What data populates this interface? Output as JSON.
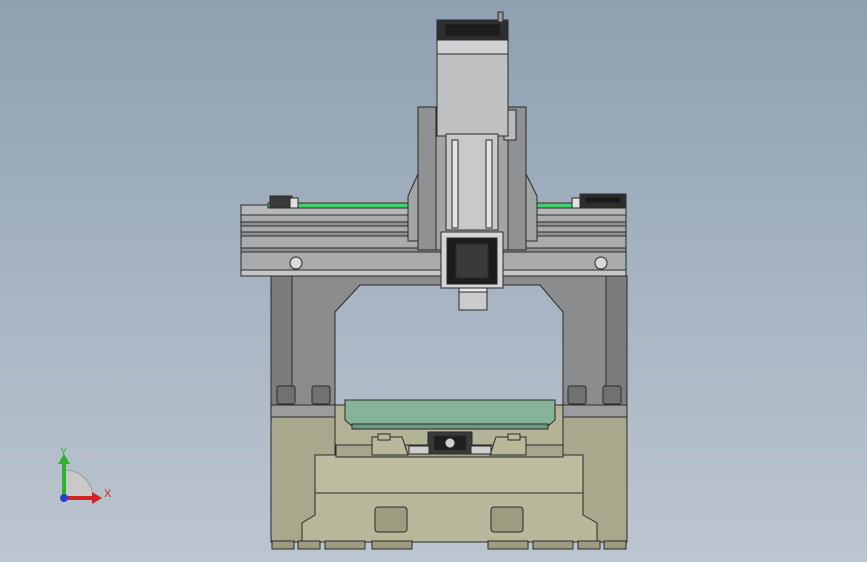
{
  "viewport": {
    "colors": {
      "background_top": "#8fa0b1",
      "background_bottom": "#bcc6d0",
      "base_casting": "#b3b396",
      "base_casting_dark": "#9c9c80",
      "column": "#8a8c8e",
      "column_dark": "#727476",
      "beam": "#a9abad",
      "linear_rail": "#3fd36a",
      "spindle_head": "#bfc1c3",
      "worktable": "#88b39b",
      "worktable_dark": "#6e9a82",
      "outline": "#2a2a2a"
    }
  },
  "triad": {
    "x_label": "X",
    "y_label": "Y",
    "x_color": "#d42121",
    "y_color": "#2bb32b",
    "z_color": "#2a3fd0"
  }
}
